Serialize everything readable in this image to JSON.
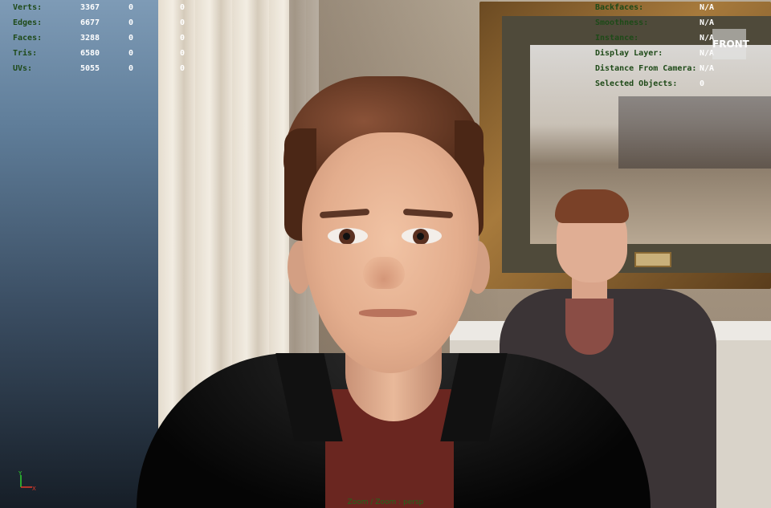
{
  "hud_left": {
    "rows": [
      {
        "label": "Verts:",
        "v1": "3367",
        "v2": "0",
        "v3": "0"
      },
      {
        "label": "Edges:",
        "v1": "6677",
        "v2": "0",
        "v3": "0"
      },
      {
        "label": "Faces:",
        "v1": "3288",
        "v2": "0",
        "v3": "0"
      },
      {
        "label": "Tris:",
        "v1": "6580",
        "v2": "0",
        "v3": "0"
      },
      {
        "label": "UVs:",
        "v1": "5055",
        "v2": "0",
        "v3": "0"
      }
    ]
  },
  "hud_right": {
    "rows": [
      {
        "label": "Backfaces:",
        "value": "N/A"
      },
      {
        "label": "Smoothness:",
        "value": "N/A"
      },
      {
        "label": "Instance:",
        "value": "N/A"
      },
      {
        "label": "Display Layer:",
        "value": "N/A"
      },
      {
        "label": "Distance From Camera:",
        "value": "N/A"
      },
      {
        "label": "Selected Objects:",
        "value": "0"
      }
    ]
  },
  "view_label": "FRONT",
  "status_text": "Zoom / Zoom : persp",
  "axis": {
    "y_label": "Y",
    "x_label": "X",
    "y_color": "#2fd12f",
    "x_color": "#e23a2a"
  },
  "colors": {
    "hud_label": "#1e4a18",
    "hud_value": "#ffffff"
  }
}
